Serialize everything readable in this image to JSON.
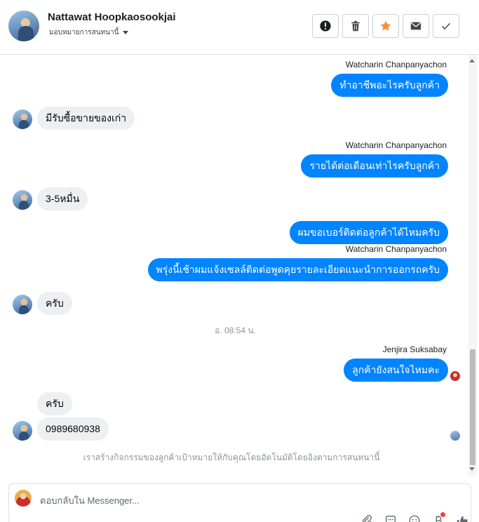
{
  "header": {
    "contact_name": "Nattawat Hoopkaosookjai",
    "assign_label": "มอบหมายการสนทนานี้",
    "actions": [
      {
        "name": "mark-spam-button",
        "icon": "alert-circle-icon"
      },
      {
        "name": "delete-button",
        "icon": "trash-icon"
      },
      {
        "name": "star-button",
        "icon": "star-icon"
      },
      {
        "name": "mark-unread-button",
        "icon": "envelope-icon"
      },
      {
        "name": "mark-done-button",
        "icon": "check-icon"
      }
    ]
  },
  "thread": {
    "messages": [
      {
        "sender": "Watcharin Chanpanyachon",
        "text": "ทำอาชีพอะไรครับลูกค้า",
        "direction": "outgoing"
      },
      {
        "text": "มีรับซื้อขายของเก่า",
        "direction": "incoming"
      },
      {
        "sender": "Watcharin Chanpanyachon",
        "text": "รายได้ต่อเดือนเท่าไรครับลูกค้า",
        "direction": "outgoing"
      },
      {
        "text": "3-5หมื่น",
        "direction": "incoming"
      },
      {
        "text": "ผมขอเบอร์ติดต่อลูกค้าได้ไหมครับ",
        "direction": "outgoing"
      },
      {
        "sender": "Watcharin Chanpanyachon",
        "text": "พรุ่งนี้เช้าผมแจ้งเซลล์ติดต่อพูดคุยรายละเอียดแนะนำการออกรถครับ",
        "direction": "outgoing"
      },
      {
        "text": "ครับ",
        "direction": "incoming"
      },
      {
        "sender": "Jenjira Suksabay",
        "text": "ลูกค้ายังสนใจไหมคะ",
        "direction": "outgoing"
      },
      {
        "text": "ครับ",
        "direction": "incoming"
      },
      {
        "text": "0989680938",
        "direction": "incoming"
      }
    ],
    "timestamp": "อ. 08:54 น.",
    "system_note": "เราสร้างกิจกรรมของลูกค้าเป้าหมายให้กับคุณโดยอัตโนมัติโดยอิงตามการสนทนานี้"
  },
  "composer": {
    "placeholder": "ตอบกลับใน Messenger...",
    "value": "",
    "icons": [
      "paperclip-icon",
      "saved-replies-icon",
      "emoji-icon",
      "baht-payment-icon",
      "thumbs-up-icon"
    ]
  },
  "colors": {
    "outgoing_bubble": "#0084ff",
    "incoming_bubble": "#eeeff2",
    "star_accent": "#f7923b"
  }
}
